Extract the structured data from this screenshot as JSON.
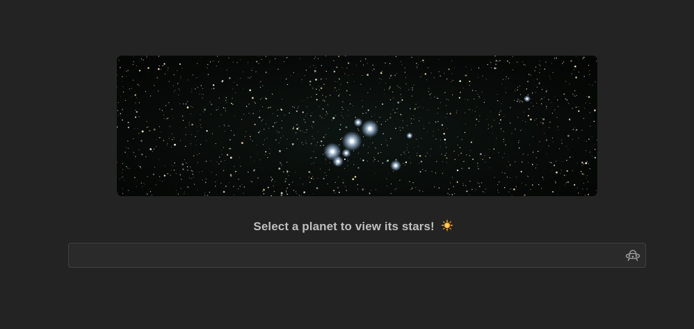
{
  "banner": {
    "icon": "starfield-image"
  },
  "prompt": {
    "text": "Select a planet to view its stars!",
    "icon": "sun-icon",
    "icon_color": "#f5a623"
  },
  "planet_select": {
    "value": "",
    "icon": "ufo-icon"
  },
  "colors": {
    "background": "#232323",
    "field": "#2a2a2a",
    "field_border": "#404040",
    "text": "#bfbfbf"
  }
}
